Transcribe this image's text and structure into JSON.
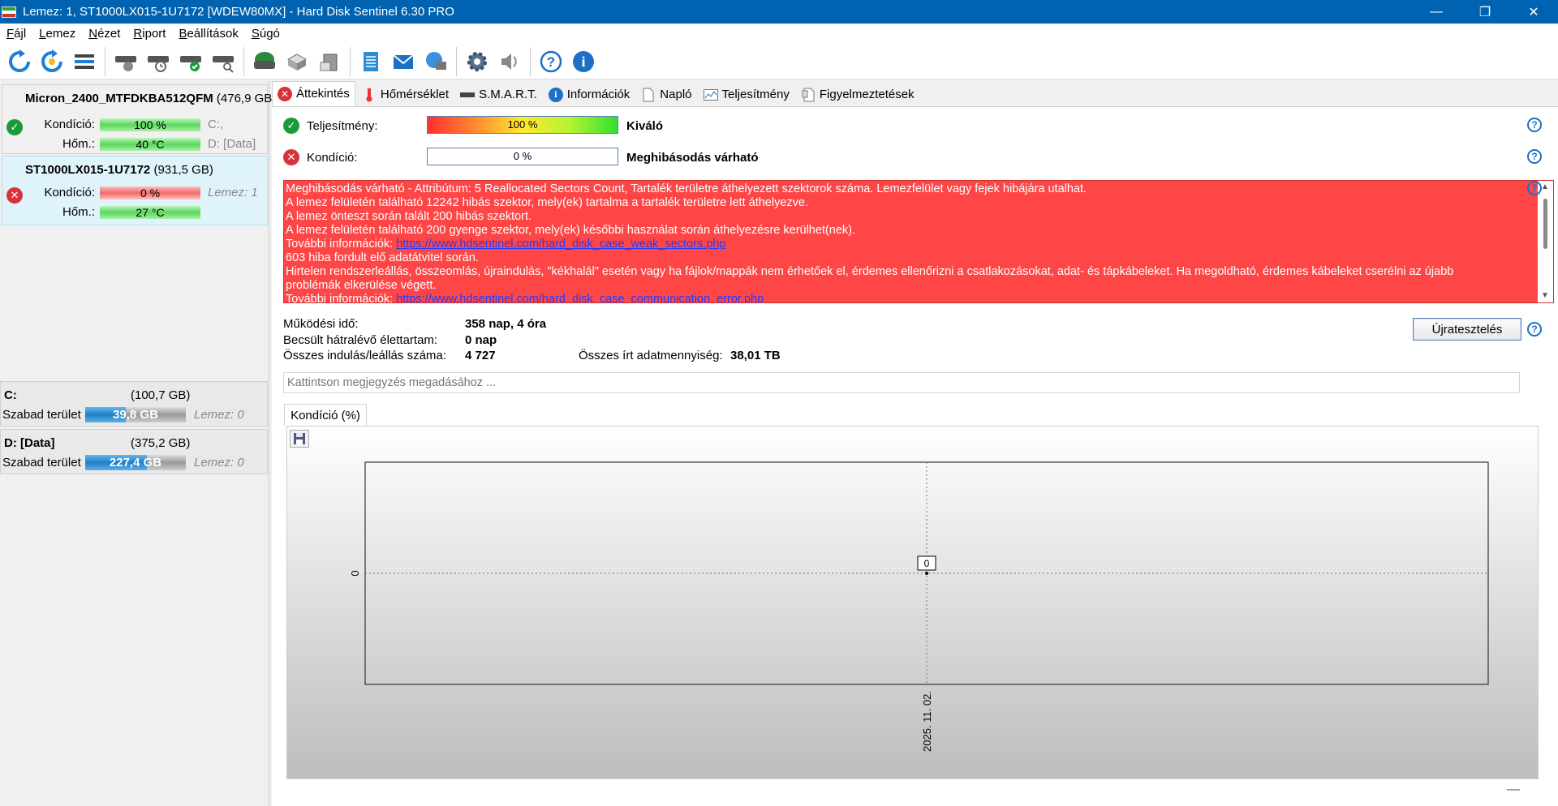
{
  "window": {
    "title": "Lemez: 1, ST1000LX015-1U7172 [WDEW80MX]  -  Hard Disk Sentinel 6.30 PRO",
    "minimize": "—",
    "maximize": "❐",
    "close": "✕"
  },
  "menu": [
    {
      "label": "Fájl"
    },
    {
      "label": "Lemez"
    },
    {
      "label": "Nézet"
    },
    {
      "label": "Riport"
    },
    {
      "label": "Beállítások"
    },
    {
      "label": "Súgó"
    }
  ],
  "toolbar_icons": [
    "refresh-icon",
    "refresh-all-icon",
    "disk-list-icon",
    "disk-test-icon",
    "disk-schedule-icon",
    "disk-ok-icon",
    "disk-search-icon",
    "disk-drive-icon",
    "disk-stack-icon",
    "disk-export-icon",
    "report-icon",
    "email-icon",
    "network-icon",
    "settings-icon",
    "sound-icon",
    "help-icon",
    "info-icon"
  ],
  "disks": [
    {
      "name": "Micron_2400_MTFDKBA512QFM",
      "size": "(476,9 GB)",
      "status": "ok",
      "condition_label": "Kondíció:",
      "condition": "100 %",
      "temp_label": "Hőm.:",
      "temp": "40 °C",
      "side1": "C:,",
      "side2": "D: [Data]"
    },
    {
      "name": "ST1000LX015-1U7172",
      "size": "(931,5 GB)",
      "status": "bad",
      "condition_label": "Kondíció:",
      "condition": "0 %",
      "temp_label": "Hőm.:",
      "temp": "27 °C",
      "side1": "Lemez: 1"
    }
  ],
  "volumes": [
    {
      "name": "C:",
      "size": "(100,7 GB)",
      "free_label": "Szabad terület",
      "free": "39,8 GB",
      "free_fraction": 0.4,
      "disk": "Lemez: 0"
    },
    {
      "name": "D: [Data]",
      "size": "(375,2 GB)",
      "free_label": "Szabad terület",
      "free": "227,4 GB",
      "free_fraction": 0.61,
      "disk": "Lemez: 0"
    }
  ],
  "tabs": [
    {
      "label": "Áttekintés",
      "icon": "error-icon",
      "active": true
    },
    {
      "label": "Hőmérséklet",
      "icon": "thermometer-icon"
    },
    {
      "label": "S.M.A.R.T.",
      "icon": "disk-icon"
    },
    {
      "label": "Információk",
      "icon": "info-icon"
    },
    {
      "label": "Napló",
      "icon": "document-icon"
    },
    {
      "label": "Teljesítmény",
      "icon": "performance-chart-icon"
    },
    {
      "label": "Figyelmeztetések",
      "icon": "alerts-icon"
    }
  ],
  "overview": {
    "performance_label": "Teljesítmény:",
    "performance_value": "100 %",
    "performance_text": "Kiváló",
    "condition_label": "Kondíció:",
    "condition_value": "0 %",
    "condition_text": "Meghibásodás várható",
    "alert_lines": [
      "Meghibásodás várható - Attribútum: 5 Reallocated Sectors Count, Tartalék területre áthelyezett szektorok száma. Lemezfelület vagy fejek hibájára utalhat.",
      "A lemez felületén található 12242 hibás szektor, mely(ek) tartalma a tartalék területre lett áthelyezve.",
      "A lemez önteszt során talált 200 hibás szektort.",
      "A lemez felületén található 200 gyenge szektor, mely(ek) későbbi használat során áthelyezésre kerülhet(nek)."
    ],
    "more_info_label_1": "További információk: ",
    "more_info_link_1": "https://www.hdsentinel.com/hard_disk_case_weak_sectors.php",
    "alert_line_5": "603 hiba fordult elő adatátvitel során.",
    "alert_line_6": "Hirtelen rendszerleállás, összeomlás, újraindulás, \"kékhalál\" esetén vagy ha fájlok/mappák nem érhetőek el, érdemes ellenőrizni a csatlakozásokat, adat- és tápkábeleket. Ha megoldható, érdemes kábeleket cserélni az újabb",
    "alert_line_7": "problémák elkerülése végett.",
    "more_info_label_2": "További információk: ",
    "more_info_link_2": "https://www.hdsentinel.com/hard_disk_case_communication_error.php",
    "uptime_label": "Működési idő:",
    "uptime": "358 nap, 4 óra",
    "lifetime_label": "Becsült hátralévő élettartam:",
    "lifetime": "0 nap",
    "starts_label": "Összes indulás/leállás száma:",
    "starts": "4 727",
    "written_label": "Összes írt adatmennyiség:",
    "written": "38,01 TB",
    "restart_button": "Újratesztelés",
    "note_placeholder": "Kattintson megjegyzés megadásához ..."
  },
  "chart_tab_label": "Kondíció  (%)",
  "chart_data": {
    "type": "line",
    "x": [
      "2025. 11. 02."
    ],
    "series": [
      {
        "values": [
          0
        ]
      }
    ],
    "y_tick_labels": [
      "0"
    ],
    "data_labels": [
      "0"
    ],
    "grid": true
  },
  "colors": {
    "titlebar": "#0063b1",
    "alert_bg": "#ff4646",
    "selected_disk_bg": "#dff3fb",
    "ok_green": "#1a9b3a",
    "bad_red": "#d8333b"
  }
}
